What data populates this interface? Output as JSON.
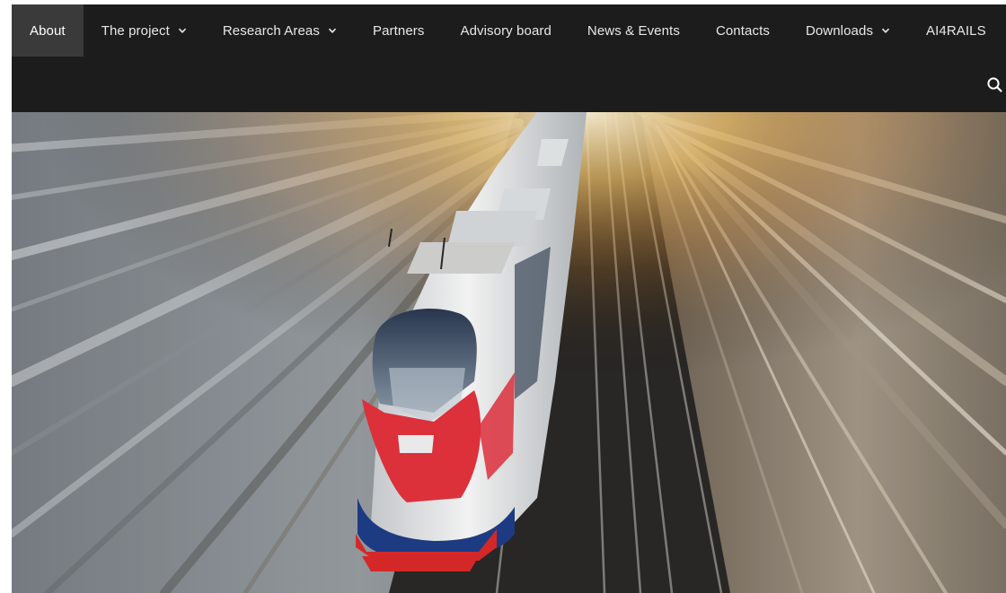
{
  "nav": {
    "items": [
      {
        "label": "About",
        "active": true,
        "has_dropdown": false
      },
      {
        "label": "The project",
        "active": false,
        "has_dropdown": true
      },
      {
        "label": "Research Areas",
        "active": false,
        "has_dropdown": true
      },
      {
        "label": "Partners",
        "active": false,
        "has_dropdown": false
      },
      {
        "label": "Advisory board",
        "active": false,
        "has_dropdown": false
      },
      {
        "label": "News & Events",
        "active": false,
        "has_dropdown": false
      },
      {
        "label": "Contacts",
        "active": false,
        "has_dropdown": false
      },
      {
        "label": "Downloads",
        "active": false,
        "has_dropdown": true
      },
      {
        "label": "AI4RAILS",
        "active": false,
        "has_dropdown": false
      }
    ],
    "search_icon": "search-icon",
    "dropdown_icon": "chevron-down-icon"
  },
  "colors": {
    "nav_background": "#1c1c1c",
    "nav_active_background": "#3a3a3a",
    "nav_text": "#e8e8e8"
  },
  "hero": {
    "image": "high-speed-train-motion-blur",
    "train_colors": [
      "#f2f2f2",
      "#e8333f",
      "#1f3f8a"
    ]
  }
}
